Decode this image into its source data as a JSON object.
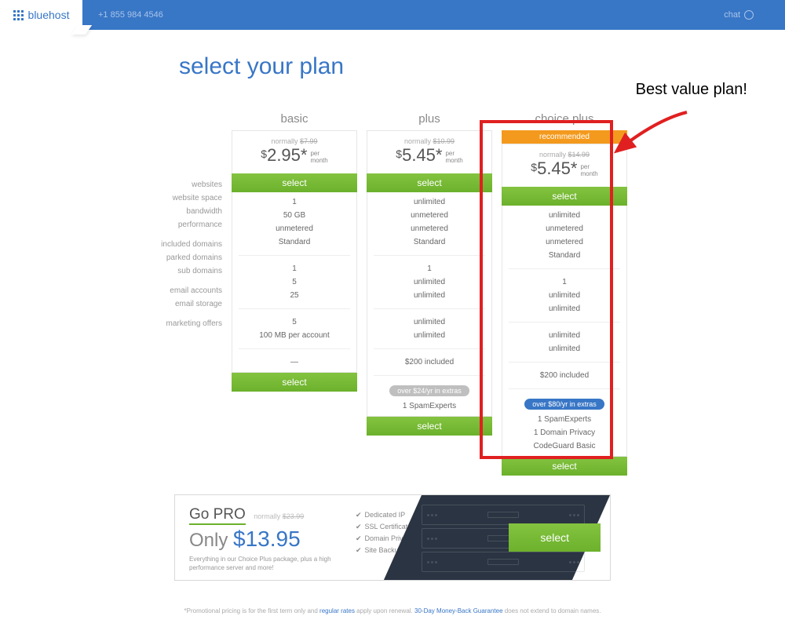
{
  "header": {
    "brand": "bluehost",
    "phone": "+1 855 984 4546",
    "chat": "chat"
  },
  "page_title": "select your plan",
  "annotation": "Best value plan!",
  "labels": {
    "websites": "websites",
    "website_space": "website space",
    "bandwidth": "bandwidth",
    "performance": "performance",
    "included_domains": "included domains",
    "parked_domains": "parked domains",
    "sub_domains": "sub domains",
    "email_accounts": "email accounts",
    "email_storage": "email storage",
    "marketing_offers": "marketing offers"
  },
  "plans": [
    {
      "name": "basic",
      "normally": "normally ",
      "normally_strike": "$7.99",
      "currency": "$",
      "price": "2.95",
      "per_a": "per",
      "per_b": "month",
      "asterisk": "*",
      "select": "select",
      "f": {
        "websites": "1",
        "website_space": "50 GB",
        "bandwidth": "unmetered",
        "performance": "Standard",
        "included_domains": "1",
        "parked_domains": "5",
        "sub_domains": "25",
        "email_accounts": "5",
        "email_storage": "100 MB per account",
        "marketing_offers": "—"
      }
    },
    {
      "name": "plus",
      "normally": "normally ",
      "normally_strike": "$10.99",
      "currency": "$",
      "price": "5.45",
      "per_a": "per",
      "per_b": "month",
      "asterisk": "*",
      "select": "select",
      "f": {
        "websites": "unlimited",
        "website_space": "unmetered",
        "bandwidth": "unmetered",
        "performance": "Standard",
        "included_domains": "1",
        "parked_domains": "unlimited",
        "sub_domains": "unlimited",
        "email_accounts": "unlimited",
        "email_storage": "unlimited",
        "marketing_offers": "$200 included"
      },
      "extras_pill": "over $24/yr in extras",
      "extras": [
        "1 SpamExperts"
      ]
    },
    {
      "name": "choice plus",
      "recommended": "recommended",
      "normally": "normally ",
      "normally_strike": "$14.99",
      "currency": "$",
      "price": "5.45",
      "per_a": "per",
      "per_b": "month",
      "asterisk": "*",
      "select": "select",
      "f": {
        "websites": "unlimited",
        "website_space": "unmetered",
        "bandwidth": "unmetered",
        "performance": "Standard",
        "included_domains": "1",
        "parked_domains": "unlimited",
        "sub_domains": "unlimited",
        "email_accounts": "unlimited",
        "email_storage": "unlimited",
        "marketing_offers": "$200 included"
      },
      "extras_pill": "over $80/yr in extras",
      "extras": [
        "1 SpamExperts",
        "1 Domain Privacy",
        "CodeGuard Basic"
      ]
    }
  ],
  "pro": {
    "title": "Go PRO",
    "normally": "normally ",
    "normally_strike": "$23.99",
    "only": "Only ",
    "price": "$13.95",
    "desc": "Everything in our Choice Plus package, plus a high performance server and more!",
    "features": [
      "Dedicated IP",
      "SSL Certificate",
      "Domain Privacy",
      "Site Backup"
    ],
    "select": "select"
  },
  "footnote": {
    "a": "*Promotional pricing is for the first term only and ",
    "link1": "regular rates",
    "b": " apply upon renewal. ",
    "link2": "30-Day Money-Back Guarantee",
    "c": " does not extend to domain names."
  }
}
